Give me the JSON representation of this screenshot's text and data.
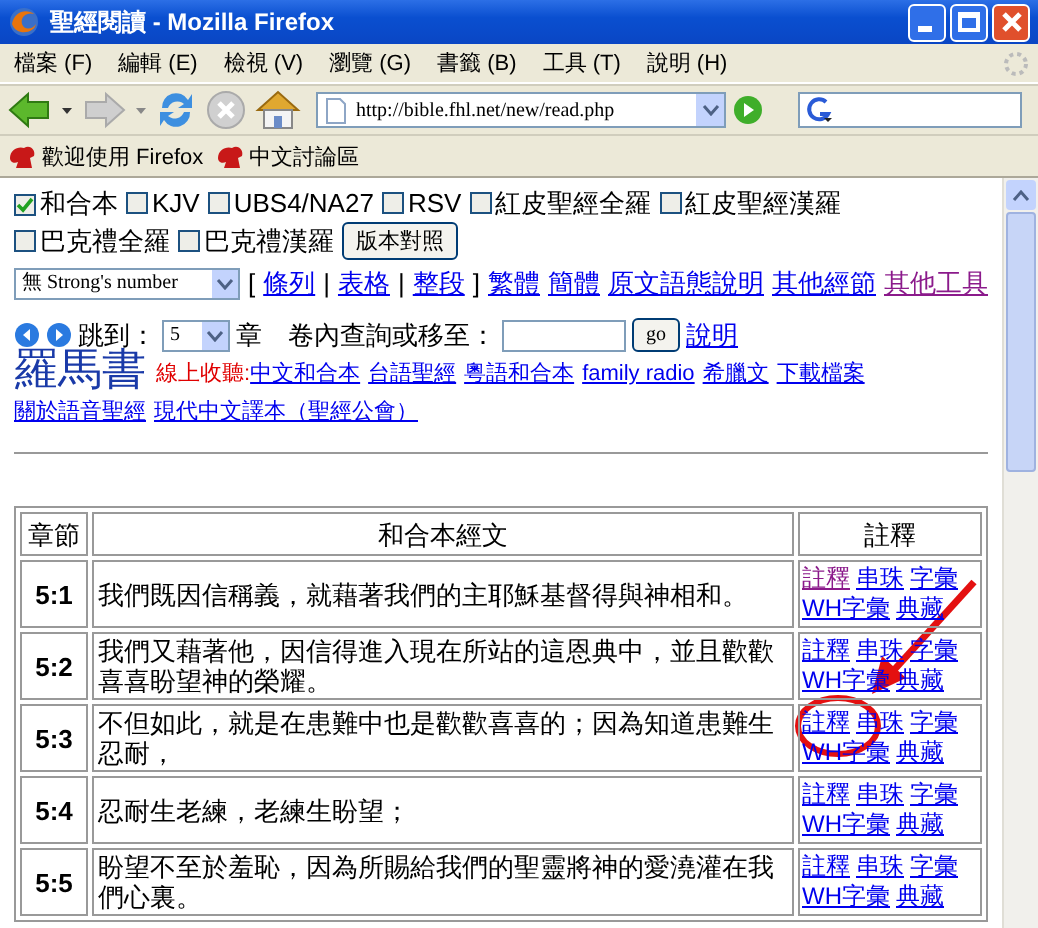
{
  "window": {
    "title": "聖經閱讀 - Mozilla Firefox"
  },
  "menu": [
    "檔案 (F)",
    "編輯 (E)",
    "檢視 (V)",
    "瀏覽 (G)",
    "書籤 (B)",
    "工具 (T)",
    "說明 (H)"
  ],
  "toolbar": {
    "back_enabled": true,
    "forward_enabled": false,
    "stop_enabled": false,
    "url": "http://bible.fhl.net/new/read.php"
  },
  "bookmarks": [
    "歡迎使用 Firefox",
    "中文討論區"
  ],
  "versions": [
    {
      "label": "和合本",
      "checked": true
    },
    {
      "label": "KJV",
      "checked": false
    },
    {
      "label": "UBS4/NA27",
      "checked": false
    },
    {
      "label": "RSV",
      "checked": false
    },
    {
      "label": "紅皮聖經全羅",
      "checked": false
    },
    {
      "label": "紅皮聖經漢羅",
      "checked": false
    },
    {
      "label": "巴克禮全羅",
      "checked": false
    },
    {
      "label": "巴克禮漢羅",
      "checked": false
    }
  ],
  "compare_button": "版本對照",
  "strong_select": "無 Strong's number",
  "layout_brackets": {
    "open": "[",
    "separator": "|",
    "close": "]"
  },
  "layout_links": [
    {
      "label": "條列",
      "visited": false
    },
    {
      "label": "表格",
      "visited": false
    },
    {
      "label": "整段",
      "visited": false
    }
  ],
  "tool_links": [
    {
      "label": "繁體",
      "visited": false
    },
    {
      "label": "簡體",
      "visited": false
    },
    {
      "label": "原文語態說明",
      "visited": false
    },
    {
      "label": "其他經節",
      "visited": false
    },
    {
      "label": "其他工具",
      "visited": true
    }
  ],
  "jump": {
    "label": "跳到：",
    "chapter": "5",
    "chapter_unit": "章",
    "search_label": "卷內查詢或移至：",
    "go": "go",
    "help": "說明"
  },
  "book": {
    "title": "羅馬書",
    "audio_label": "線上收聽:",
    "audio_links": [
      "中文和合本",
      "台語聖經",
      "粵語和合本",
      "family radio",
      "希臘文",
      "下載檔案",
      "關於語音聖經",
      "現代中文譯本（聖經公會）"
    ]
  },
  "table": {
    "columns": [
      "章節",
      "和合本經文",
      "註釋"
    ],
    "rows": [
      {
        "ref": "5:1",
        "text": "我們既因信稱義，就藉著我們的主耶穌基督得與神相和。",
        "notes": [
          {
            "label": "註釋",
            "visited": true
          },
          {
            "label": "串珠",
            "visited": false
          },
          {
            "label": "字彙",
            "visited": false
          },
          {
            "label": "WH字彙",
            "visited": false
          },
          {
            "label": "典藏",
            "visited": false
          }
        ]
      },
      {
        "ref": "5:2",
        "text": "我們又藉著他，因信得進入現在所站的這恩典中，並且歡歡喜喜盼望神的榮耀。",
        "notes": [
          {
            "label": "註釋",
            "visited": false
          },
          {
            "label": "串珠",
            "visited": false
          },
          {
            "label": "字彙",
            "visited": false
          },
          {
            "label": "WH字彙",
            "visited": false
          },
          {
            "label": "典藏",
            "visited": false
          }
        ]
      },
      {
        "ref": "5:3",
        "text": "不但如此，就是在患難中也是歡歡喜喜的；因為知道患難生忍耐，",
        "notes": [
          {
            "label": "註釋",
            "visited": false
          },
          {
            "label": "串珠",
            "visited": false
          },
          {
            "label": "字彙",
            "visited": false
          },
          {
            "label": "WH字彙",
            "visited": false
          },
          {
            "label": "典藏",
            "visited": false
          }
        ]
      },
      {
        "ref": "5:4",
        "text": "忍耐生老練，老練生盼望；",
        "notes": [
          {
            "label": "註釋",
            "visited": false
          },
          {
            "label": "串珠",
            "visited": false
          },
          {
            "label": "字彙",
            "visited": false
          },
          {
            "label": "WH字彙",
            "visited": false
          },
          {
            "label": "典藏",
            "visited": false
          }
        ]
      },
      {
        "ref": "5:5",
        "text": "盼望不至於羞恥，因為所賜給我們的聖靈將神的愛澆灌在我們心裏。",
        "notes": [
          {
            "label": "註釋",
            "visited": false
          },
          {
            "label": "串珠",
            "visited": false
          },
          {
            "label": "字彙",
            "visited": false
          },
          {
            "label": "WH字彙",
            "visited": false
          },
          {
            "label": "典藏",
            "visited": false
          }
        ]
      }
    ]
  }
}
